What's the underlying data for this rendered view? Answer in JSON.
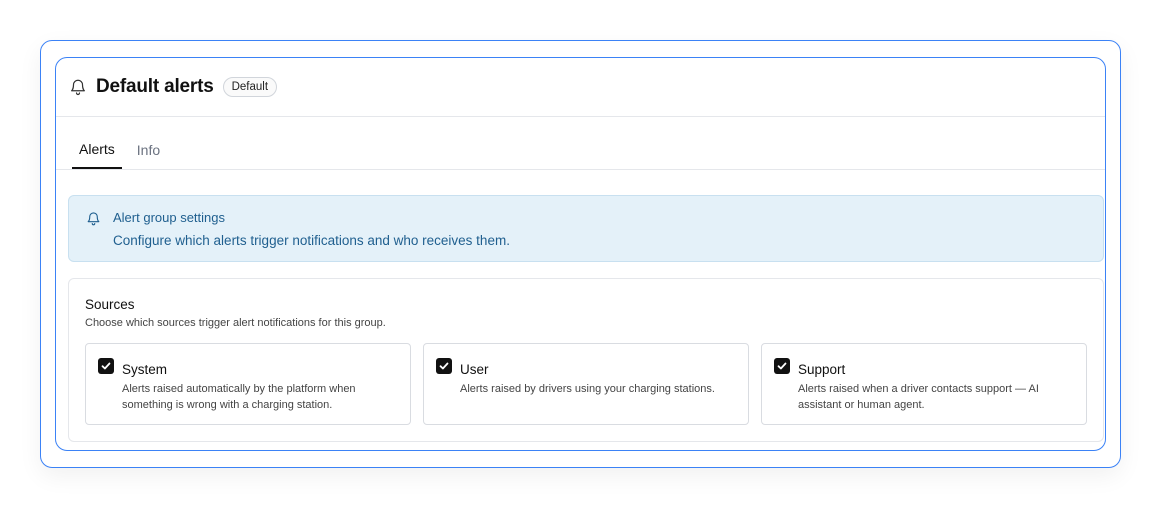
{
  "header": {
    "title": "Default alerts",
    "badge": "Default",
    "icon": "bell-icon"
  },
  "tabs": [
    {
      "label": "Alerts",
      "active": true
    },
    {
      "label": "Info",
      "active": false
    }
  ],
  "info_banner": {
    "icon": "bell-icon",
    "title": "Alert group settings",
    "description": "Configure which alerts trigger notifications and who receives them."
  },
  "sources": {
    "title": "Sources",
    "description": "Choose which sources trigger alert notifications for this group.",
    "items": [
      {
        "label": "System",
        "checked": true,
        "description": "Alerts raised automatically by the platform when something is wrong with a charging station."
      },
      {
        "label": "User",
        "checked": true,
        "description": "Alerts raised by drivers using your charging stations."
      },
      {
        "label": "Support",
        "checked": true,
        "description": "Alerts raised when a driver contacts support — AI assistant or human agent."
      }
    ]
  },
  "colors": {
    "accent_border": "#3b82f6",
    "banner_bg": "#e4f1f9",
    "banner_text": "#1f5f8f"
  }
}
